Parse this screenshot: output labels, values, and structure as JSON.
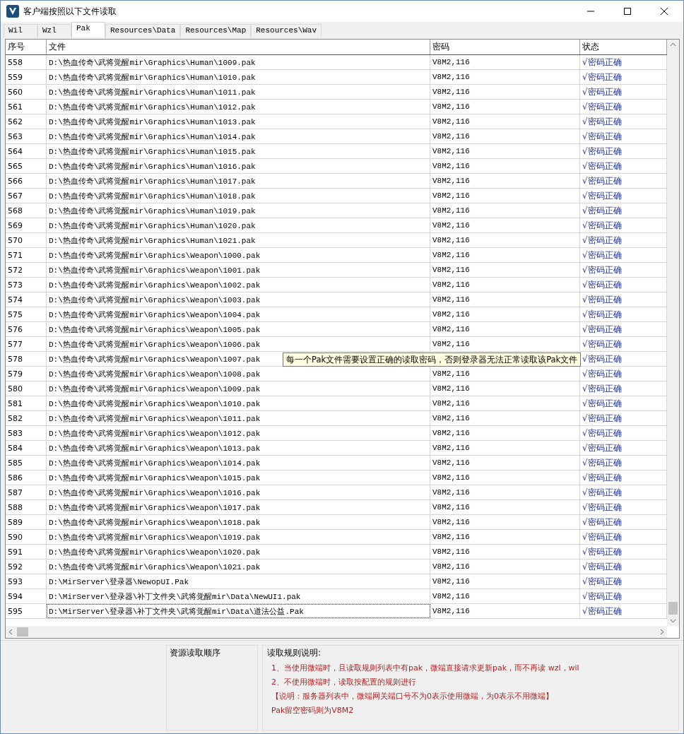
{
  "window": {
    "title": "客户端按照以下文件读取"
  },
  "tabs": [
    {
      "label": "Wil",
      "selected": false
    },
    {
      "label": "Wzl",
      "selected": false
    },
    {
      "label": "Pak",
      "selected": true
    },
    {
      "label": "Resources\\Data",
      "selected": false
    },
    {
      "label": "Resources\\Map",
      "selected": false
    },
    {
      "label": "Resources\\Wav",
      "selected": false
    }
  ],
  "table": {
    "columns": [
      "序号",
      "文件",
      "密码",
      "状态"
    ],
    "rows": [
      {
        "no": "558",
        "file": "D:\\热血传奇\\武将觉醒mir\\Graphics\\Human\\1009.pak",
        "password": "V8M2,116",
        "status": "√密码正确",
        "focused": false
      },
      {
        "no": "559",
        "file": "D:\\热血传奇\\武将觉醒mir\\Graphics\\Human\\1010.pak",
        "password": "V8M2,116",
        "status": "√密码正确",
        "focused": false
      },
      {
        "no": "560",
        "file": "D:\\热血传奇\\武将觉醒mir\\Graphics\\Human\\1011.pak",
        "password": "V8M2,116",
        "status": "√密码正确",
        "focused": false
      },
      {
        "no": "561",
        "file": "D:\\热血传奇\\武将觉醒mir\\Graphics\\Human\\1012.pak",
        "password": "V8M2,116",
        "status": "√密码正确",
        "focused": false
      },
      {
        "no": "562",
        "file": "D:\\热血传奇\\武将觉醒mir\\Graphics\\Human\\1013.pak",
        "password": "V8M2,116",
        "status": "√密码正确",
        "focused": false
      },
      {
        "no": "563",
        "file": "D:\\热血传奇\\武将觉醒mir\\Graphics\\Human\\1014.pak",
        "password": "V8M2,116",
        "status": "√密码正确",
        "focused": false
      },
      {
        "no": "564",
        "file": "D:\\热血传奇\\武将觉醒mir\\Graphics\\Human\\1015.pak",
        "password": "V8M2,116",
        "status": "√密码正确",
        "focused": false
      },
      {
        "no": "565",
        "file": "D:\\热血传奇\\武将觉醒mir\\Graphics\\Human\\1016.pak",
        "password": "V8M2,116",
        "status": "√密码正确",
        "focused": false
      },
      {
        "no": "566",
        "file": "D:\\热血传奇\\武将觉醒mir\\Graphics\\Human\\1017.pak",
        "password": "V8M2,116",
        "status": "√密码正确",
        "focused": false
      },
      {
        "no": "567",
        "file": "D:\\热血传奇\\武将觉醒mir\\Graphics\\Human\\1018.pak",
        "password": "V8M2,116",
        "status": "√密码正确",
        "focused": false
      },
      {
        "no": "568",
        "file": "D:\\热血传奇\\武将觉醒mir\\Graphics\\Human\\1019.pak",
        "password": "V8M2,116",
        "status": "√密码正确",
        "focused": false
      },
      {
        "no": "569",
        "file": "D:\\热血传奇\\武将觉醒mir\\Graphics\\Human\\1020.pak",
        "password": "V8M2,116",
        "status": "√密码正确",
        "focused": false
      },
      {
        "no": "570",
        "file": "D:\\热血传奇\\武将觉醒mir\\Graphics\\Human\\1021.pak",
        "password": "V8M2,116",
        "status": "√密码正确",
        "focused": false
      },
      {
        "no": "571",
        "file": "D:\\热血传奇\\武将觉醒mir\\Graphics\\Weapon\\1000.pak",
        "password": "V8M2,116",
        "status": "√密码正确",
        "focused": false
      },
      {
        "no": "572",
        "file": "D:\\热血传奇\\武将觉醒mir\\Graphics\\Weapon\\1001.pak",
        "password": "V8M2,116",
        "status": "√密码正确",
        "focused": false
      },
      {
        "no": "573",
        "file": "D:\\热血传奇\\武将觉醒mir\\Graphics\\Weapon\\1002.pak",
        "password": "V8M2,116",
        "status": "√密码正确",
        "focused": false
      },
      {
        "no": "574",
        "file": "D:\\热血传奇\\武将觉醒mir\\Graphics\\Weapon\\1003.pak",
        "password": "V8M2,116",
        "status": "√密码正确",
        "focused": false
      },
      {
        "no": "575",
        "file": "D:\\热血传奇\\武将觉醒mir\\Graphics\\Weapon\\1004.pak",
        "password": "V8M2,116",
        "status": "√密码正确",
        "focused": false
      },
      {
        "no": "576",
        "file": "D:\\热血传奇\\武将觉醒mir\\Graphics\\Weapon\\1005.pak",
        "password": "V8M2,116",
        "status": "√密码正确",
        "focused": false
      },
      {
        "no": "577",
        "file": "D:\\热血传奇\\武将觉醒mir\\Graphics\\Weapon\\1006.pak",
        "password": "V8M2,116",
        "status": "√密码正确",
        "focused": false
      },
      {
        "no": "578",
        "file": "D:\\热血传奇\\武将觉醒mir\\Graphics\\Weapon\\1007.pak",
        "status": "√密码正确",
        "focused": false
      },
      {
        "no": "579",
        "file": "D:\\热血传奇\\武将觉醒mir\\Graphics\\Weapon\\1008.pak",
        "password": "V8M2,116",
        "status": "√密码正确",
        "focused": false
      },
      {
        "no": "580",
        "file": "D:\\热血传奇\\武将觉醒mir\\Graphics\\Weapon\\1009.pak",
        "password": "V8M2,116",
        "status": "√密码正确",
        "focused": false
      },
      {
        "no": "581",
        "file": "D:\\热血传奇\\武将觉醒mir\\Graphics\\Weapon\\1010.pak",
        "password": "V8M2,116",
        "status": "√密码正确",
        "focused": false
      },
      {
        "no": "582",
        "file": "D:\\热血传奇\\武将觉醒mir\\Graphics\\Weapon\\1011.pak",
        "password": "V8M2,116",
        "status": "√密码正确",
        "focused": false
      },
      {
        "no": "583",
        "file": "D:\\热血传奇\\武将觉醒mir\\Graphics\\Weapon\\1012.pak",
        "password": "V8M2,116",
        "status": "√密码正确",
        "focused": false
      },
      {
        "no": "584",
        "file": "D:\\热血传奇\\武将觉醒mir\\Graphics\\Weapon\\1013.pak",
        "password": "V8M2,116",
        "status": "√密码正确",
        "focused": false
      },
      {
        "no": "585",
        "file": "D:\\热血传奇\\武将觉醒mir\\Graphics\\Weapon\\1014.pak",
        "password": "V8M2,116",
        "status": "√密码正确",
        "focused": false
      },
      {
        "no": "586",
        "file": "D:\\热血传奇\\武将觉醒mir\\Graphics\\Weapon\\1015.pak",
        "password": "V8M2,116",
        "status": "√密码正确",
        "focused": false
      },
      {
        "no": "587",
        "file": "D:\\热血传奇\\武将觉醒mir\\Graphics\\Weapon\\1016.pak",
        "password": "V8M2,116",
        "status": "√密码正确",
        "focused": false
      },
      {
        "no": "588",
        "file": "D:\\热血传奇\\武将觉醒mir\\Graphics\\Weapon\\1017.pak",
        "password": "V8M2,116",
        "status": "√密码正确",
        "focused": false
      },
      {
        "no": "589",
        "file": "D:\\热血传奇\\武将觉醒mir\\Graphics\\Weapon\\1018.pak",
        "password": "V8M2,116",
        "status": "√密码正确",
        "focused": false
      },
      {
        "no": "590",
        "file": "D:\\热血传奇\\武将觉醒mir\\Graphics\\Weapon\\1019.pak",
        "password": "V8M2,116",
        "status": "√密码正确",
        "focused": false
      },
      {
        "no": "591",
        "file": "D:\\热血传奇\\武将觉醒mir\\Graphics\\Weapon\\1020.pak",
        "password": "V8M2,116",
        "status": "√密码正确",
        "focused": false
      },
      {
        "no": "592",
        "file": "D:\\热血传奇\\武将觉醒mir\\Graphics\\Weapon\\1021.pak",
        "password": "V8M2,116",
        "status": "√密码正确",
        "focused": false
      },
      {
        "no": "593",
        "file": "D:\\MirServer\\登录器\\NewopUI.Pak",
        "password": "V8M2,116",
        "status": "√密码正确",
        "focused": false
      },
      {
        "no": "594",
        "file": "D:\\MirServer\\登录器\\补丁文件夹\\武将觉醒mir\\Data\\NewUI1.pak",
        "password": "V8M2,116",
        "status": "√密码正确",
        "focused": false
      },
      {
        "no": "595",
        "file": "D:\\MirServer\\登录器\\补丁文件夹\\武将觉醒mir\\Data\\道法公益.Pak",
        "password": "V8M2,116",
        "status": "√密码正确",
        "focused": true
      }
    ]
  },
  "tooltip": {
    "text": "每一个Pak文件需要设置正确的读取密码，否则登录器无法正常读取该Pak文件"
  },
  "order_panel": {
    "title": "资源读取顺序"
  },
  "rules_panel": {
    "title": "读取规则说明:",
    "lines": [
      "1、当使用微端时，且读取规则列表中有pak，微端直接请求更新pak，而不再读 wzl，wil",
      "2、不使用微端时，读取按配置的规则进行",
      "【说明：服务器列表中，微端网关端口号不为0表示使用微端，为0表示不用微端】",
      "Pak留空密码则为V8M2"
    ]
  }
}
